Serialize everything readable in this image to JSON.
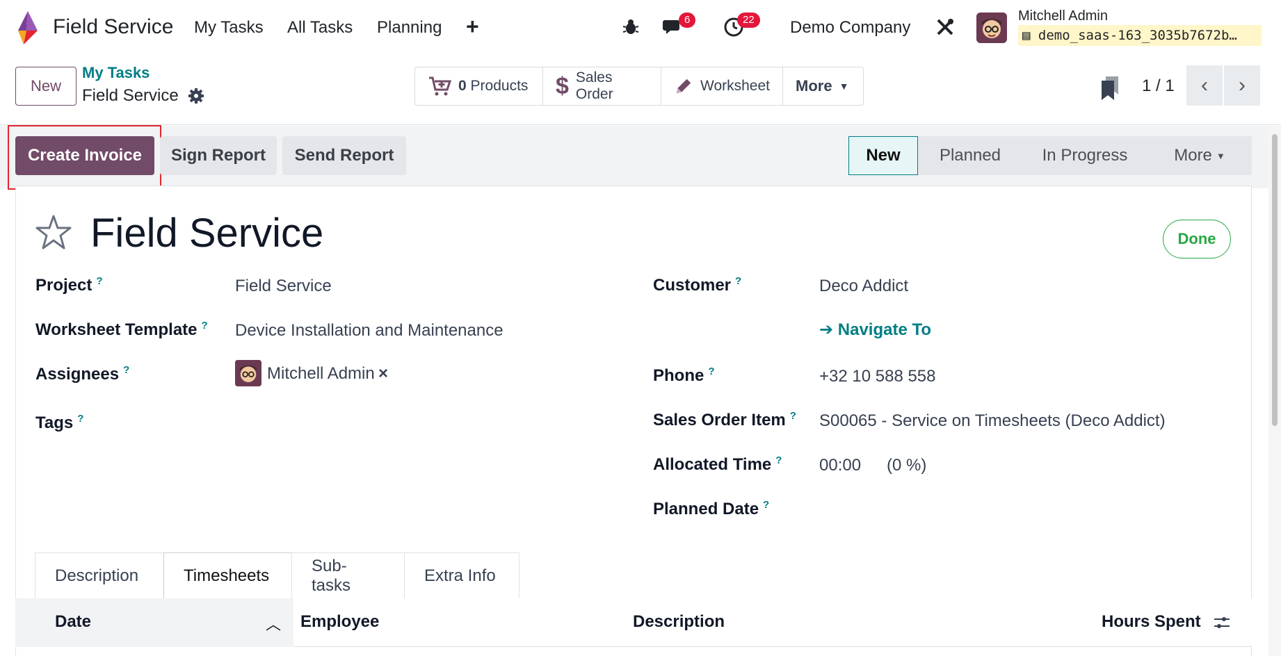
{
  "navbar": {
    "app_name": "Field Service",
    "menu": [
      "My Tasks",
      "All Tasks",
      "Planning"
    ],
    "plus": "+",
    "messages_badge": "6",
    "activities_badge": "22",
    "company": "Demo Company",
    "user_name": "Mitchell Admin",
    "database": "demo_saas-163_3035b7672b…"
  },
  "control_panel": {
    "new_label": "New",
    "breadcrumb_parent": "My Tasks",
    "breadcrumb_current": "Field Service",
    "stat_buttons": {
      "products_count": "0",
      "products_label": "Products",
      "sales_order_label": "Sales Order",
      "worksheet_label": "Worksheet",
      "more_label": "More"
    },
    "pager": "1 / 1"
  },
  "statusbar": {
    "create_invoice": "Create Invoice",
    "sign_report": "Sign Report",
    "send_report": "Send Report",
    "stages": [
      "New",
      "Planned",
      "In Progress",
      "More"
    ],
    "active_stage": "New"
  },
  "form": {
    "title": "Field Service",
    "done_label": "Done",
    "help_mark": "?",
    "left_fields": {
      "project_label": "Project",
      "project_value": "Field Service",
      "worksheet_label": "Worksheet Template",
      "worksheet_value": "Device Installation and Maintenance",
      "assignees_label": "Assignees",
      "assignee_value": "Mitchell Admin",
      "assignee_remove": "×",
      "tags_label": "Tags"
    },
    "right_fields": {
      "customer_label": "Customer",
      "customer_value": "Deco Addict",
      "navigate_label": "Navigate To",
      "phone_label": "Phone",
      "phone_value": "+32 10 588 558",
      "so_item_label": "Sales Order Item",
      "so_item_value": "S00065 - Service on Timesheets (Deco Addict)",
      "allocated_label": "Allocated Time",
      "allocated_value": "00:00",
      "allocated_pct": "(0 %)",
      "planned_label": "Planned Date"
    },
    "tabs": [
      "Description",
      "Timesheets",
      "Sub-tasks",
      "Extra Info"
    ],
    "active_tab": "Timesheets",
    "table_headers": {
      "date": "Date",
      "employee": "Employee",
      "description": "Description",
      "hours": "Hours Spent"
    }
  },
  "colors": {
    "brand": "#714b67",
    "accent": "#017e84",
    "badge": "#e3173b",
    "done": "#28a745",
    "highlight": "#e3262f"
  }
}
